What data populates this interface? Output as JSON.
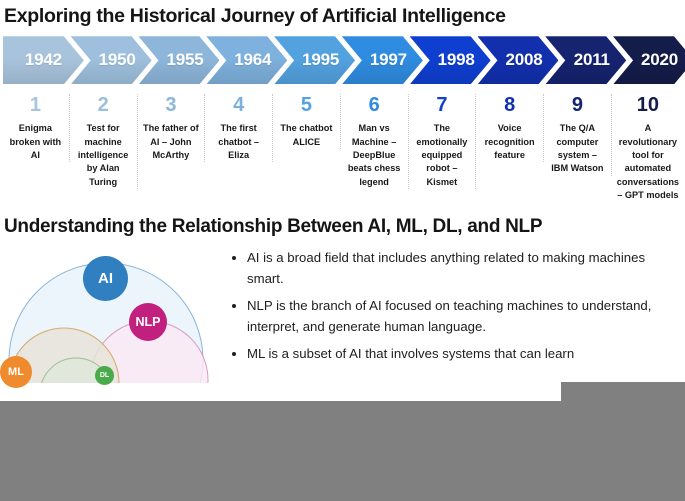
{
  "section1": {
    "title": "Exploring the Historical Journey of Artificial Intelligence",
    "timeline": [
      {
        "year": "1942",
        "color": "#a8c4dd"
      },
      {
        "year": "1950",
        "color": "#9ec0de"
      },
      {
        "year": "1955",
        "color": "#8db6da"
      },
      {
        "year": "1964",
        "color": "#7eb1dd"
      },
      {
        "year": "1995",
        "color": "#53a2e0"
      },
      {
        "year": "1997",
        "color": "#2f8ce0"
      },
      {
        "year": "1998",
        "color": "#0f3fd1"
      },
      {
        "year": "2008",
        "color": "#1230ae"
      },
      {
        "year": "2011",
        "color": "#16236f"
      },
      {
        "year": "2020",
        "color": "#141c4a"
      }
    ],
    "items": [
      {
        "num": "1",
        "color": "#a9c5de",
        "desc": "Enigma broken with AI"
      },
      {
        "num": "2",
        "color": "#9bbfdd",
        "desc": "Test for machine intelligence by Alan Turing"
      },
      {
        "num": "3",
        "color": "#8cb7db",
        "desc": "The father of AI – John McArthy"
      },
      {
        "num": "4",
        "color": "#7db1dd",
        "desc": "The first chatbot – Eliza"
      },
      {
        "num": "5",
        "color": "#53a2e0",
        "desc": "The chatbot ALICE"
      },
      {
        "num": "6",
        "color": "#2f8ce0",
        "desc": "Man vs Machine – DeepBlue beats chess legend"
      },
      {
        "num": "7",
        "color": "#1240cf",
        "desc": "The emotionally equipped robot – Kismet"
      },
      {
        "num": "8",
        "color": "#1230ae",
        "desc": "Voice recognition feature"
      },
      {
        "num": "9",
        "color": "#16236f",
        "desc": "The Q/A computer system – IBM Watson"
      },
      {
        "num": "10",
        "color": "#141c4a",
        "desc": "A revolutionary tool for automated conversations – GPT models"
      }
    ]
  },
  "section2": {
    "title": "Understanding the Relationship Between AI, ML, DL, and NLP",
    "venn": {
      "circles": [
        {
          "name": "ai-circle",
          "fill": "#e8f3fb",
          "stroke": "#8ab4d8"
        },
        {
          "name": "nlp-circle",
          "fill": "#fbe9f3",
          "stroke": "#d99bc2"
        },
        {
          "name": "ml-circle",
          "fill": "#e7e3d8",
          "stroke": "#d8a86a"
        },
        {
          "name": "dl-circle",
          "fill": "#dfe8da",
          "stroke": "#9dbf93"
        }
      ],
      "badges": [
        {
          "label": "AI",
          "color": "#2f7fc1",
          "text_color": "#ffffff"
        },
        {
          "label": "NLP",
          "color": "#c2207e",
          "text_color": "#ffffff"
        },
        {
          "label": "ML",
          "color": "#ef8b2c",
          "text_color": "#ffffff"
        },
        {
          "label": "DL",
          "color": "#4aa94a",
          "text_color": "#ffffff"
        }
      ]
    },
    "bullets": [
      "AI is a broad field that includes anything related to making machines smart.",
      "NLP is the branch of AI focused on teaching machines to understand, interpret, and generate human language.",
      "ML is a subset of AI that involves systems that can learn"
    ]
  },
  "overlay": {
    "color": "#808080"
  }
}
